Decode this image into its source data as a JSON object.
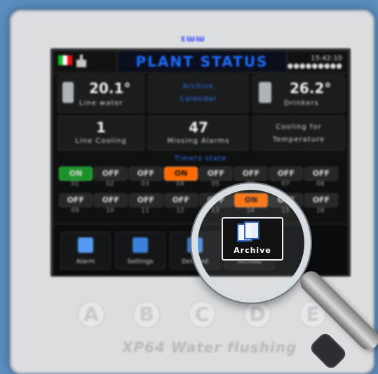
{
  "device": {
    "brand_led": "ɛɯɯ",
    "name": "XP64 Water flushing",
    "soft_keys": [
      "A",
      "B",
      "C",
      "D",
      "E"
    ]
  },
  "screen": {
    "title": "PLANT STATUS",
    "clock": {
      "line1": "15:42:10",
      "line2": "●●●●●●●●●"
    },
    "row1": {
      "left": {
        "value": "20.1°",
        "label": "Line water"
      },
      "center": {
        "line1": "Archive",
        "line2": "Calendar"
      },
      "right": {
        "value": "26.2°",
        "label": "Drinkers"
      }
    },
    "row2": {
      "a": {
        "value": "1",
        "label": "Line Cooling"
      },
      "b": {
        "value": "47",
        "label": "Missing Alarms"
      },
      "c": {
        "line1": "Cooling for",
        "line2": "Temperature"
      }
    },
    "timers": {
      "title": "Timers state",
      "row1": {
        "states": [
          "ON",
          "OFF",
          "OFF",
          "ON",
          "OFF",
          "OFF",
          "OFF",
          "OFF"
        ],
        "indices": [
          "01",
          "02",
          "03",
          "04",
          "05",
          "06",
          "07",
          "08"
        ]
      },
      "row2": {
        "states": [
          "OFF",
          "OFF",
          "OFF",
          "OFF",
          "OFF",
          "ON",
          "OFF",
          "OFF"
        ],
        "indices": [
          "09",
          "10",
          "11",
          "12",
          "13",
          "14",
          "15",
          "16"
        ]
      }
    },
    "bottom_buttons": [
      {
        "label": "Alarm"
      },
      {
        "label": "Settings"
      },
      {
        "label": "Detailed"
      },
      {
        "label": "Archive"
      }
    ]
  },
  "magnifier": {
    "focused_label": "Archive"
  },
  "colors": {
    "title_blue": "#1e6cff",
    "on_green": "#1d8f2b",
    "warn_orange": "#ff6a00"
  }
}
